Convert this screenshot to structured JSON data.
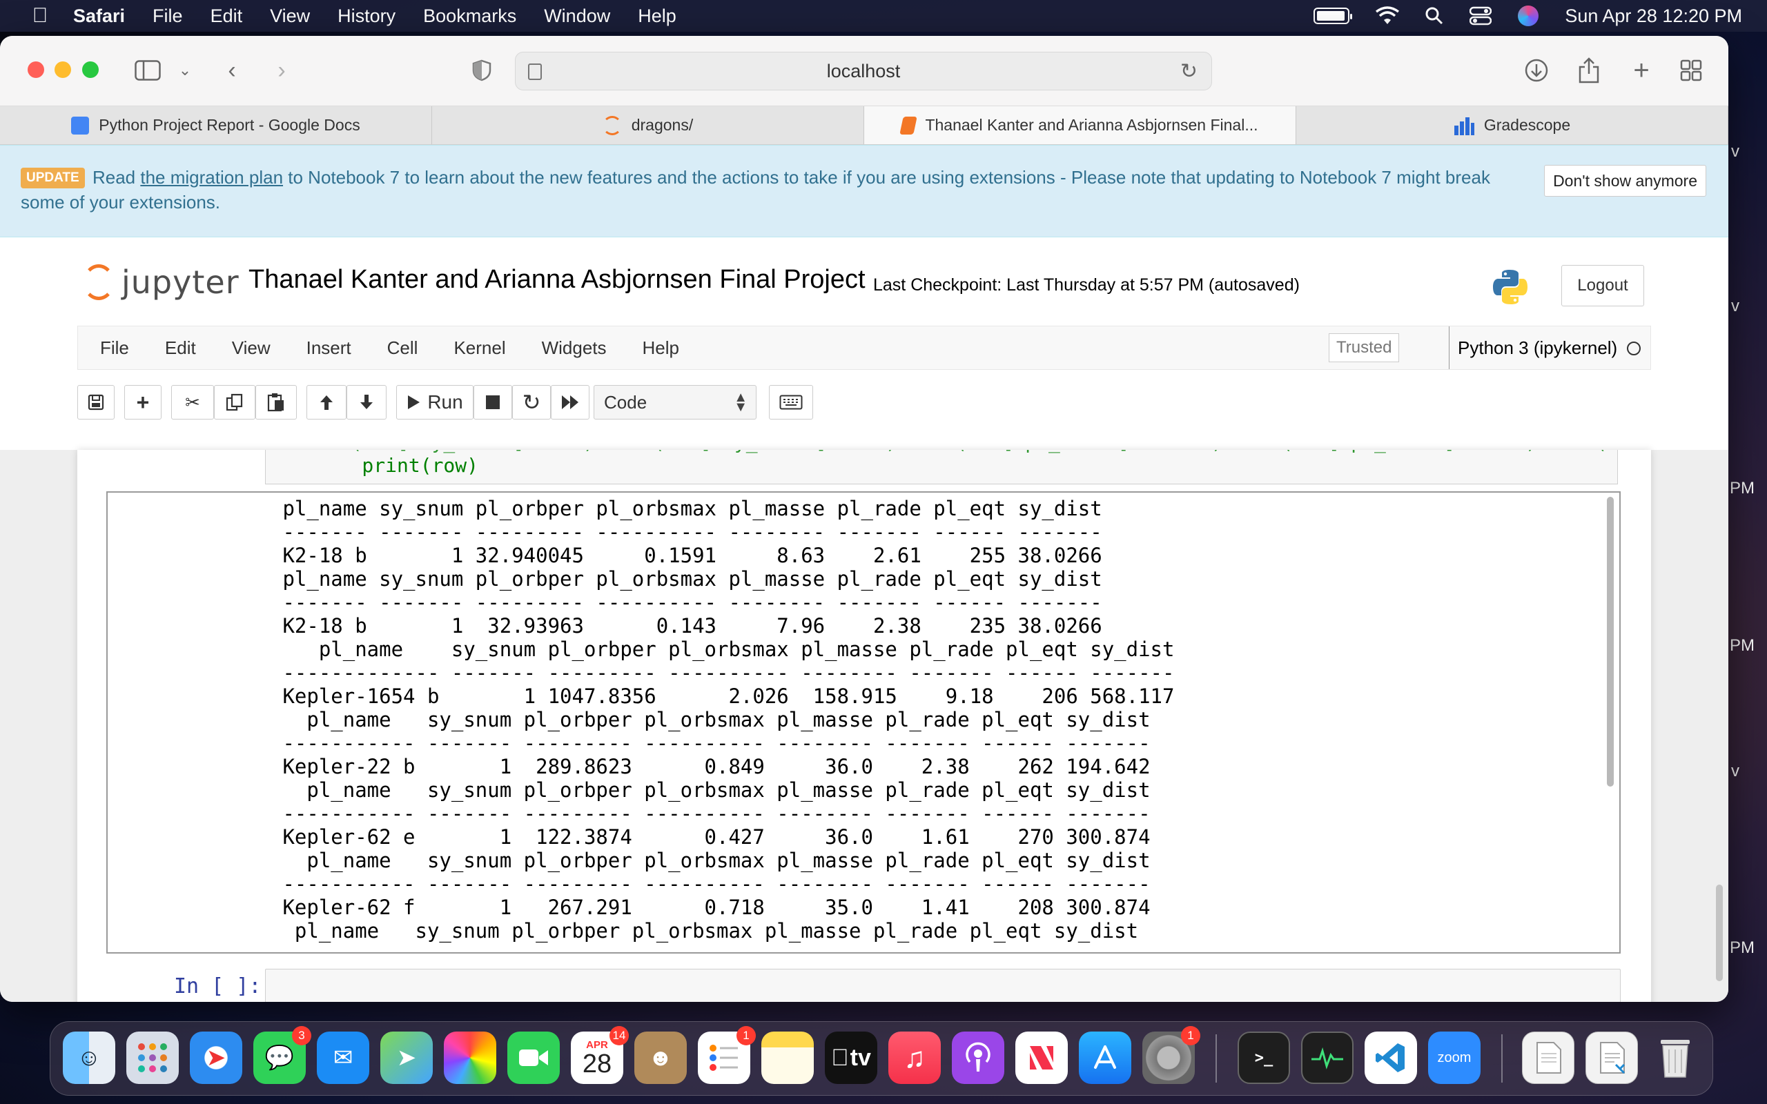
{
  "menubar": {
    "app": "Safari",
    "items": [
      "File",
      "Edit",
      "View",
      "History",
      "Bookmarks",
      "Window",
      "Help"
    ],
    "datetime": "Sun Apr 28  12:20 PM"
  },
  "safari": {
    "url": "localhost",
    "tabs": [
      {
        "label": "Python Project Report - Google Docs"
      },
      {
        "label": "dragons/"
      },
      {
        "label": "Thanael Kanter and Arianna Asbjornsen Final..."
      },
      {
        "label": "Gradescope"
      }
    ]
  },
  "banner": {
    "badge": "UPDATE",
    "text_before": "Read ",
    "link": "the migration plan",
    "text_after": " to Notebook 7 to learn about the new features and the actions to take if you are using extensions - Please note that updating to Notebook 7 might break some of your extensions.",
    "dismiss": "Don't show anymore"
  },
  "jupyter": {
    "logo_text": "jupyter",
    "notebook_title": "Thanael Kanter and Arianna Asbjornsen Final Project",
    "checkpoint": "Last Checkpoint: Last Thursday at 5:57 PM   (autosaved)",
    "logout": "Logout",
    "menu": [
      "File",
      "Edit",
      "View",
      "Insert",
      "Cell",
      "Kernel",
      "Widgets",
      "Help"
    ],
    "trusted": "Trusted",
    "kernel": "Python 3 (ipykernel)",
    "run_label": "Run",
    "cell_type": "Code",
    "code_tail": [
      "    print(row)"
    ],
    "output": " pl_name sy_snum pl_orbper pl_orbsmax pl_masse pl_rade pl_eqt sy_dist\n ------- ------- --------- ---------- -------- ------- ------ -------\n K2-18 b       1 32.940045     0.1591     8.63    2.61    255 38.0266\n pl_name sy_snum pl_orbper pl_orbsmax pl_masse pl_rade pl_eqt sy_dist\n ------- ------- --------- ---------- -------- ------- ------ -------\n K2-18 b       1  32.93963      0.143     7.96    2.38    235 38.0266\n    pl_name    sy_snum pl_orbper pl_orbsmax pl_masse pl_rade pl_eqt sy_dist\n ------------- ------- --------- ---------- -------- ------- ------ -------\n Kepler-1654 b       1 1047.8356      2.026  158.915    9.18    206 568.117\n   pl_name   sy_snum pl_orbper pl_orbsmax pl_masse pl_rade pl_eqt sy_dist\n ----------- ------- --------- ---------- -------- ------- ------ -------\n Kepler-22 b       1  289.8623      0.849     36.0    2.38    262 194.642\n   pl_name   sy_snum pl_orbper pl_orbsmax pl_masse pl_rade pl_eqt sy_dist\n ----------- ------- --------- ---------- -------- ------- ------ -------\n Kepler-62 e       1  122.3874      0.427     36.0    1.61    270 300.874\n   pl_name   sy_snum pl_orbper pl_orbsmax pl_masse pl_rade pl_eqt sy_dist\n ----------- ------- --------- ---------- -------- ------- ------ -------\n Kepler-62 f       1   267.291      0.718     35.0    1.41    208 300.874\n  pl_name   sy_snum pl_orbper pl_orbsmax pl_masse pl_rade pl_eqt sy_dist",
    "in_prompt": "In [ ]:"
  },
  "dock": {
    "badges": {
      "messages": "3",
      "calendar": "14",
      "reminders": "1",
      "settings": "1"
    },
    "calendar_month": "APR",
    "calendar_day": "28",
    "tv_label": "tv",
    "zoom_label": "zoom"
  },
  "desktop_fragments": [
    "v",
    "v",
    "PM",
    "PM",
    "v",
    "PM"
  ],
  "colors": {
    "jupyter_orange": "#f37726",
    "banner_bg": "#d9edf7",
    "prompt_blue": "#303f9f"
  }
}
